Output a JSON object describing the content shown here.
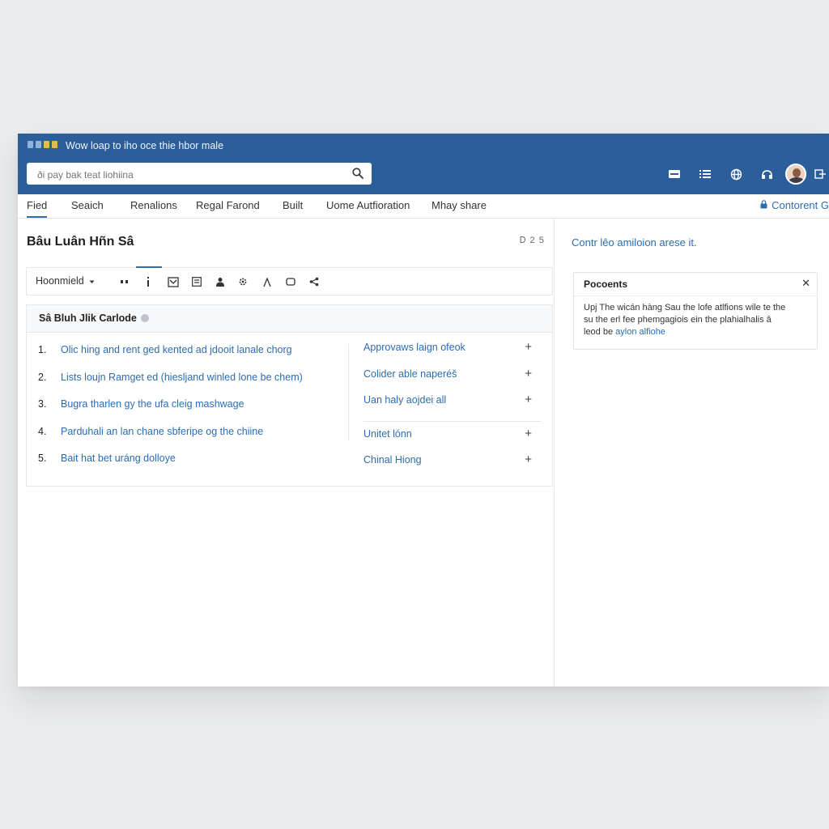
{
  "window": {
    "title": "Wow loap to iho oce thie hbor male",
    "app_icon_colors": [
      "#8fb3dc",
      "#8fb3dc",
      "#e9b949",
      "#e9b949"
    ]
  },
  "search": {
    "placeholder": "ði pay bak teat liohiina",
    "icon": "search-icon"
  },
  "header_icons": [
    "inbox-icon",
    "list-icon",
    "globe-icon",
    "support-icon",
    "avatar",
    "exit-icon"
  ],
  "tabs": [
    {
      "label": "Fied",
      "active": true
    },
    {
      "label": "Seaich",
      "active": false
    },
    {
      "label": "Renalions",
      "active": false
    },
    {
      "label": "Regal Farond",
      "active": false
    },
    {
      "label": "Built",
      "active": false
    },
    {
      "label": "Uome Autfioration",
      "active": false
    },
    {
      "label": "Mhay share",
      "active": false
    }
  ],
  "content_link": {
    "label": "Contorent G",
    "icon": "lock-icon"
  },
  "page": {
    "title": "Bâu Luân Hñn Sâ",
    "counter": "Ꭰ 2 5"
  },
  "toolbar": {
    "format_select": "Hoonmield",
    "tools": [
      "grip-icon",
      "info-bar-icon",
      "image-icon",
      "table-icon",
      "user-icon",
      "gear-icon",
      "text-a-icon",
      "comment-icon",
      "share-icon"
    ]
  },
  "section": {
    "title": "Sâ Bluh Jlik Carlode",
    "ordered_items": [
      {
        "num": "1.",
        "text": "Olic hing and rent ged kented ad jdooit lanale chorg"
      },
      {
        "num": "2.",
        "text": "Lists loujn Ramget ed (hiesljand winled lone be chem)"
      },
      {
        "num": "3.",
        "text": "Bugra tharlen gy the ufa cleig mashwage"
      },
      {
        "num": "4.",
        "text": "Parduhali an lan chane sbferipe og the chiine"
      },
      {
        "num": "5.",
        "text": "Bait hat bet uráng dolloye"
      }
    ],
    "side_items": [
      "Approvaws laign ofeok",
      "Colider able naperéš",
      "Uan haly aojdei all",
      "Unitet lónn",
      "Chinal Hiong"
    ]
  },
  "right": {
    "header": "Contr lêo amiloion arese it.",
    "card": {
      "title": "Pocoents",
      "body_line1": "Upj The wicán hàng Sau the lofe atlfions wile te the",
      "body_line2": "su the erl fee phemgagiois ein the plahialhalis â",
      "body_line3_prefix": "leod be ",
      "body_link": "aylon alfiohe"
    }
  }
}
